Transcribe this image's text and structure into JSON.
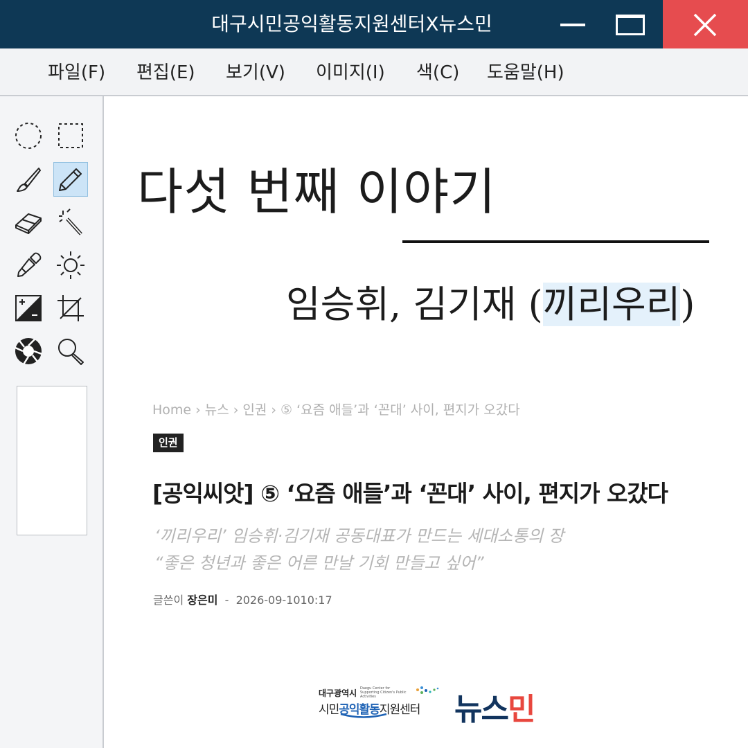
{
  "window": {
    "title": "대구시민공익활동지원센터X뉴스민",
    "close_color": "#e64c4f",
    "titlebar_color": "#0e3855"
  },
  "menu": {
    "items": [
      {
        "label": "파일(F)"
      },
      {
        "label": "편집(E)"
      },
      {
        "label": "보기(V)"
      },
      {
        "label": "이미지(I)"
      },
      {
        "label": "색(C)"
      },
      {
        "label": "도움말(H)"
      }
    ]
  },
  "tools": [
    {
      "icon": "ellipse-select-icon"
    },
    {
      "icon": "rect-select-icon"
    },
    {
      "icon": "brush-icon"
    },
    {
      "icon": "pencil-icon",
      "selected": true
    },
    {
      "icon": "eraser-icon"
    },
    {
      "icon": "magic-wand-icon"
    },
    {
      "icon": "eyedropper-icon"
    },
    {
      "icon": "brightness-icon"
    },
    {
      "icon": "contrast-icon"
    },
    {
      "icon": "crop-icon"
    },
    {
      "icon": "aperture-icon"
    },
    {
      "icon": "zoom-icon"
    }
  ],
  "canvas": {
    "story_title": "다섯 번째 이야기",
    "author_prefix": "임승휘, 김기재 (",
    "author_highlight": "끼리우리",
    "author_suffix": ")",
    "article": {
      "breadcrumb": "Home  ›  뉴스  ›  인권  ›  ⑤ ‘요즘 애들’과 ‘꼰대’ 사이, 편지가 오갔다",
      "category": "인권",
      "headline": "[공익씨앗] ⑤ ‘요즘 애들’과 ‘꼰대’ 사이, 편지가 오갔다",
      "subtitle_1": "‘끼리우리’ 임승휘·김기재 공동대표가 만드는 세대소통의 장",
      "subtitle_2": "“좋은 청년과 좋은 어른 만날 기회 만들고 싶어”",
      "byline_label": "글쓴이",
      "byline_name": "장은미",
      "byline_sep": "-",
      "byline_date": "2026-09-10",
      "byline_time": "10:17"
    },
    "logos": {
      "left_line1": "대구광역시",
      "left_line1_en": "Daegu Center for Supporting Citizen's Public Activities",
      "left_line2_a": "시민",
      "left_line2_b": "공익활동",
      "left_line2_c": "지원센터",
      "right_a": "뉴스",
      "right_b": "민"
    }
  }
}
